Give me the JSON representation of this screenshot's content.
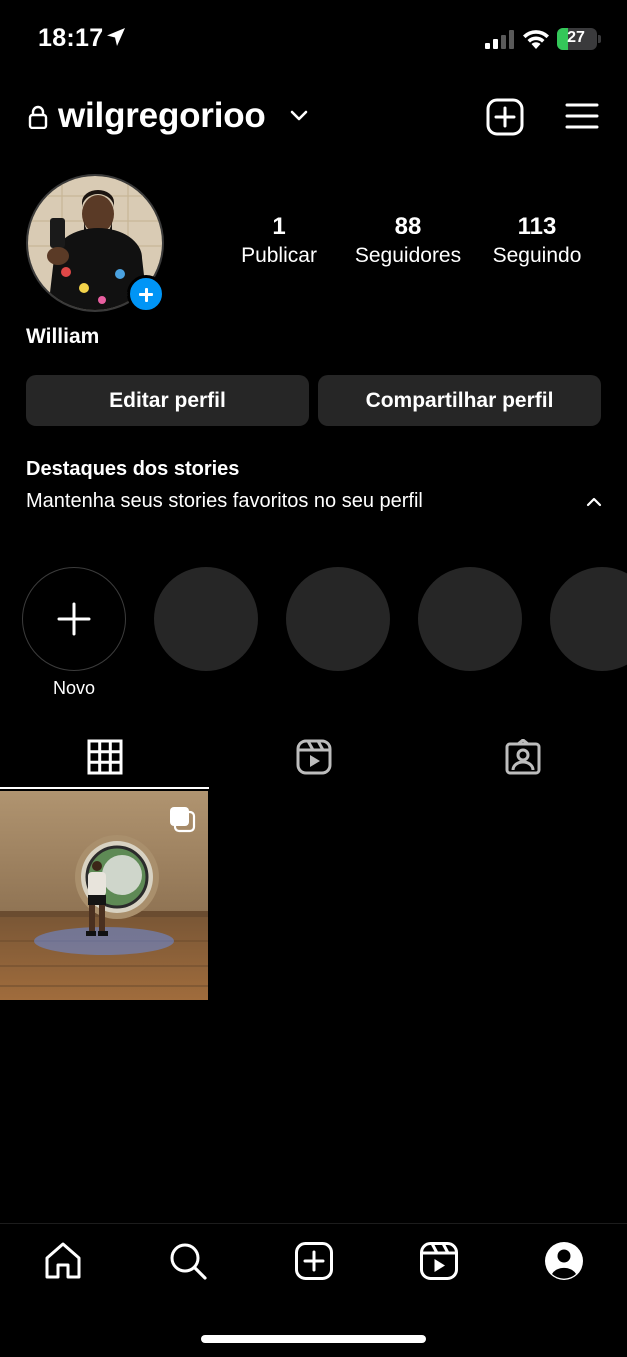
{
  "status_bar": {
    "time": "18:17",
    "battery_level": "27",
    "battery_fraction": 0.27,
    "icons": [
      "location-arrow-icon",
      "cellular-signal-icon",
      "wifi-icon",
      "battery-icon"
    ]
  },
  "header": {
    "username": "wilgregorioo",
    "icons": [
      "lock-icon",
      "chevron-down-icon",
      "new-post-icon",
      "hamburger-menu-icon"
    ]
  },
  "profile": {
    "display_name": "William",
    "stats": [
      {
        "value": "1",
        "label": "Publicar"
      },
      {
        "value": "88",
        "label": "Seguidores"
      },
      {
        "value": "113",
        "label": "Seguindo"
      }
    ]
  },
  "buttons": {
    "edit_profile": "Editar perfil",
    "share_profile": "Compartilhar perfil"
  },
  "highlights": {
    "title": "Destaques dos stories",
    "subtitle": "Mantenha seus stories favoritos no seu perfil",
    "new_label": "Novo"
  },
  "tabs": [
    "grid-icon",
    "reels-icon",
    "tagged-icon"
  ],
  "bottom_nav": [
    "home-icon",
    "search-icon",
    "create-icon",
    "reels-icon",
    "profile-icon"
  ],
  "colors": {
    "background": "#000000",
    "button": "#262626",
    "accent_blue": "#0095f6",
    "battery_green": "#34c759"
  }
}
